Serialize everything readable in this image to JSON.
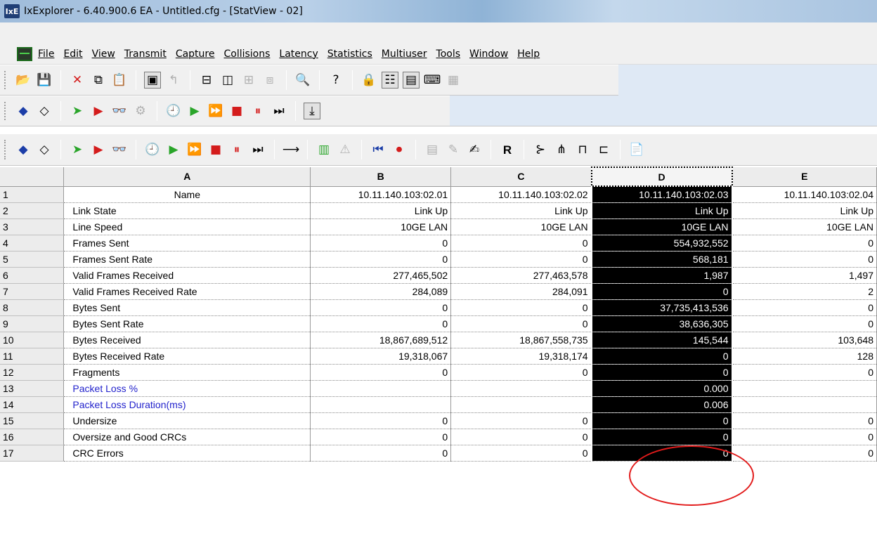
{
  "window": {
    "title": "IxExplorer - 6.40.900.6 EA - Untitled.cfg - [StatView - 02]",
    "app_icon": "IxE"
  },
  "menu": [
    "File",
    "Edit",
    "View",
    "Transmit",
    "Capture",
    "Collisions",
    "Latency",
    "Statistics",
    "Multiuser",
    "Tools",
    "Window",
    "Help"
  ],
  "toolbar_r": "R",
  "grid": {
    "columns": [
      "A",
      "B",
      "C",
      "D",
      "E"
    ],
    "selected_column": "D",
    "rows": [
      {
        "n": "1",
        "name": "Name",
        "b": "10.11.140.103:02.01",
        "c": "10.11.140.103:02.02",
        "d": "10.11.140.103:02.03",
        "e": "10.11.140.103:02.04"
      },
      {
        "n": "2",
        "name": "Link State",
        "b": "Link Up",
        "c": "Link Up",
        "d": "Link Up",
        "e": "Link Up"
      },
      {
        "n": "3",
        "name": "Line Speed",
        "b": "10GE LAN",
        "c": "10GE LAN",
        "d": "10GE LAN",
        "e": "10GE LAN"
      },
      {
        "n": "4",
        "name": "Frames Sent",
        "b": "0",
        "c": "0",
        "d": "554,932,552",
        "e": "0"
      },
      {
        "n": "5",
        "name": "Frames Sent Rate",
        "b": "0",
        "c": "0",
        "d": "568,181",
        "e": "0"
      },
      {
        "n": "6",
        "name": "Valid Frames Received",
        "b": "277,465,502",
        "c": "277,463,578",
        "d": "1,987",
        "e": "1,497"
      },
      {
        "n": "7",
        "name": "Valid Frames Received Rate",
        "b": "284,089",
        "c": "284,091",
        "d": "0",
        "e": "2"
      },
      {
        "n": "8",
        "name": "Bytes Sent",
        "b": "0",
        "c": "0",
        "d": "37,735,413,536",
        "e": "0"
      },
      {
        "n": "9",
        "name": "Bytes Sent Rate",
        "b": "0",
        "c": "0",
        "d": "38,636,305",
        "e": "0"
      },
      {
        "n": "10",
        "name": "Bytes Received",
        "b": "18,867,689,512",
        "c": "18,867,558,735",
        "d": "145,544",
        "e": "103,648"
      },
      {
        "n": "11",
        "name": "Bytes Received Rate",
        "b": "19,318,067",
        "c": "19,318,174",
        "d": "0",
        "e": "128"
      },
      {
        "n": "12",
        "name": "Fragments",
        "b": "0",
        "c": "0",
        "d": "0",
        "e": "0"
      },
      {
        "n": "13",
        "name": "Packet Loss %",
        "b": "",
        "c": "",
        "d": "0.000",
        "e": "",
        "highlight": true
      },
      {
        "n": "14",
        "name": "Packet Loss Duration(ms)",
        "b": "",
        "c": "",
        "d": "0.006",
        "e": "",
        "highlight": true
      },
      {
        "n": "15",
        "name": "Undersize",
        "b": "0",
        "c": "0",
        "d": "0",
        "e": "0"
      },
      {
        "n": "16",
        "name": "Oversize and Good CRCs",
        "b": "0",
        "c": "0",
        "d": "0",
        "e": "0"
      },
      {
        "n": "17",
        "name": "CRC Errors",
        "b": "0",
        "c": "0",
        "d": "0",
        "e": "0"
      }
    ]
  },
  "colors": {
    "selected_bg": "#000000",
    "blue_label": "#2222cc",
    "annotation": "#e21b1b"
  }
}
